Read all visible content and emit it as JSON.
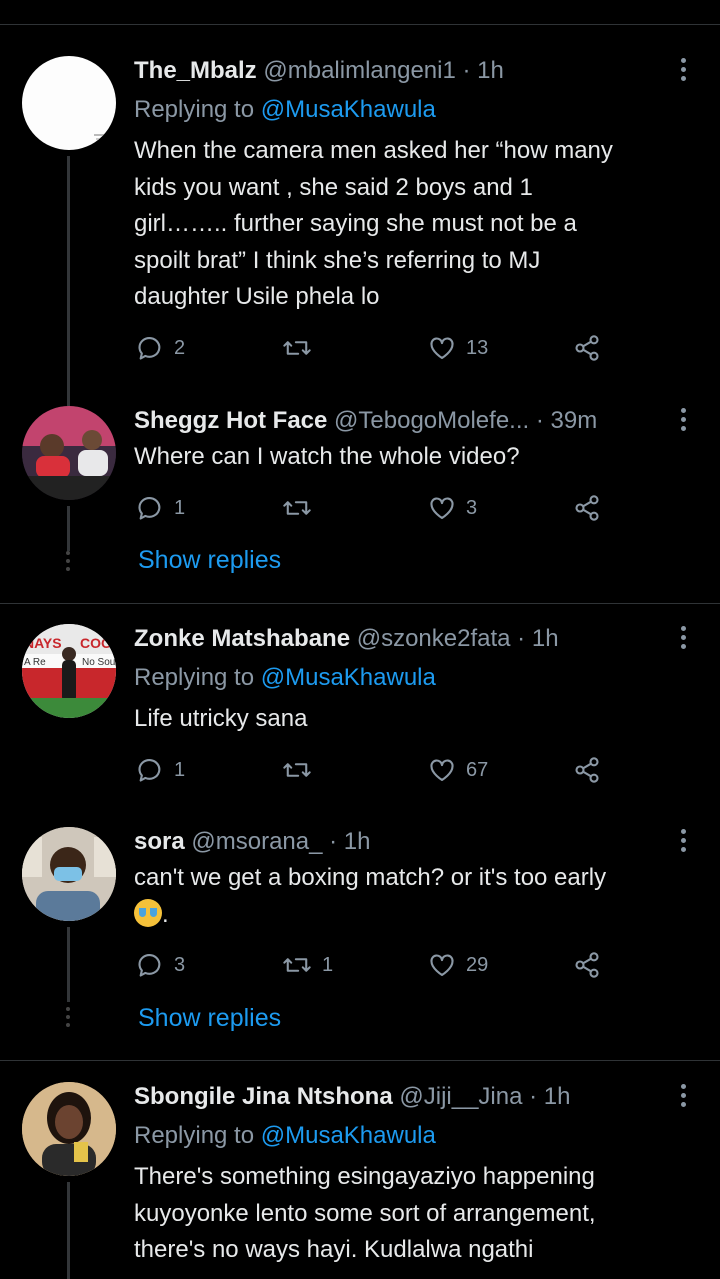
{
  "colors": {
    "background": "#000000",
    "text": "#e7e9ea",
    "muted": "#8b98a5",
    "link": "#1d9bf0",
    "divider": "#2f3336"
  },
  "tweets": [
    {
      "name": "The_Mbalz",
      "handle": "@mbalimlangeni1",
      "time": " · 1h",
      "replying_label": "Replying to",
      "replying_to": "@MusaKhawula",
      "lines": [
        "When the camera men asked her “how many",
        "kids you want , she said 2 boys and 1",
        "girl…….. further saying she must not be a",
        "spoilt brat” I think she’s referring to MJ",
        "daughter Usile phela lo"
      ],
      "replies": "2",
      "retweets": "",
      "likes": "13"
    },
    {
      "name": "Sheggz Hot Face",
      "handle": "@TebogoMolefe...",
      "time": " · 39m",
      "lines": [
        "Where can I watch the whole video?"
      ],
      "replies": "1",
      "retweets": "",
      "likes": "3",
      "show_replies": "Show replies"
    },
    {
      "name": "Zonke Matshabane",
      "handle": "@szonke2fata",
      "time": " · 1h",
      "replying_label": "Replying to",
      "replying_to": "@MusaKhawula",
      "lines": [
        "Life utricky sana"
      ],
      "replies": "1",
      "retweets": "",
      "likes": "67",
      "avatar_text": {
        "left": "NAYS",
        "right": "COON",
        "sub_left": "A Re",
        "sub_right": "No Sou"
      }
    },
    {
      "name": "sora",
      "handle": "@msorana_",
      "time": " · 1h",
      "lines": [
        "can't we get a boxing match? or it's too early"
      ],
      "emoji_name": "crying-emoji",
      "trailing": ".",
      "replies": "3",
      "retweets": "1",
      "likes": "29",
      "show_replies": "Show replies"
    },
    {
      "name": "Sbongile Jina Ntshona",
      "handle": "@Jiji__Jina",
      "time": " · 1h",
      "replying_label": "Replying to",
      "replying_to": "@MusaKhawula",
      "lines": [
        "There's something esingayaziyo happening",
        "kuyoyonke lento some sort of arrangement,",
        "there's no ways hayi. Kudlalwa ngathi"
      ]
    }
  ]
}
